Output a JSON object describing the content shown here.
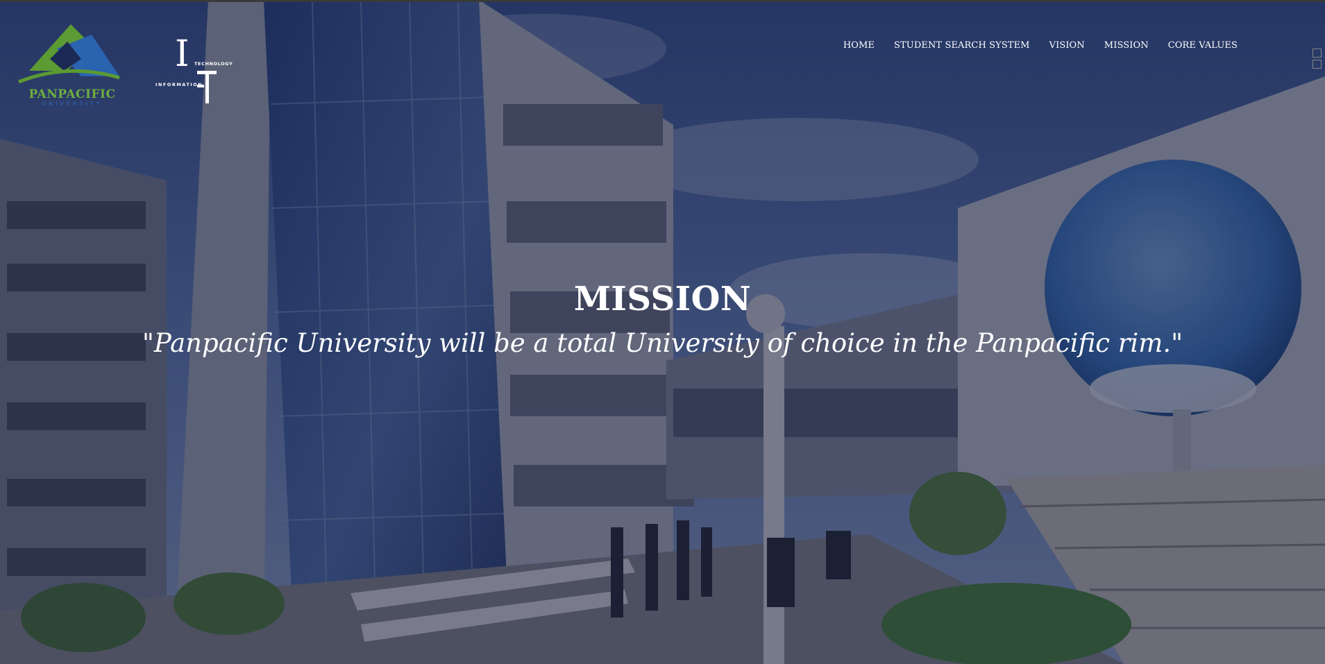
{
  "logos": {
    "university": {
      "name": "PANPACIFIC",
      "sub": "UNIVERSITY"
    },
    "department": {
      "letter": "I",
      "top_word": "TECHNOLOGY",
      "bottom_word": "INFORMATION"
    }
  },
  "nav": {
    "items": [
      {
        "label": "HOME"
      },
      {
        "label": "STUDENT SEARCH SYSTEM"
      },
      {
        "label": "VISION"
      },
      {
        "label": "MISSION"
      },
      {
        "label": "CORE VALUES"
      }
    ]
  },
  "hero": {
    "title": "MISSION",
    "statement": "\"Panpacific University will be a total University of choice in the Panpacific rim.\""
  },
  "colors": {
    "overlay": "#0e1230",
    "logo_green": "#6fae3e",
    "logo_blue": "#2f69b3",
    "text": "#ffffff"
  }
}
